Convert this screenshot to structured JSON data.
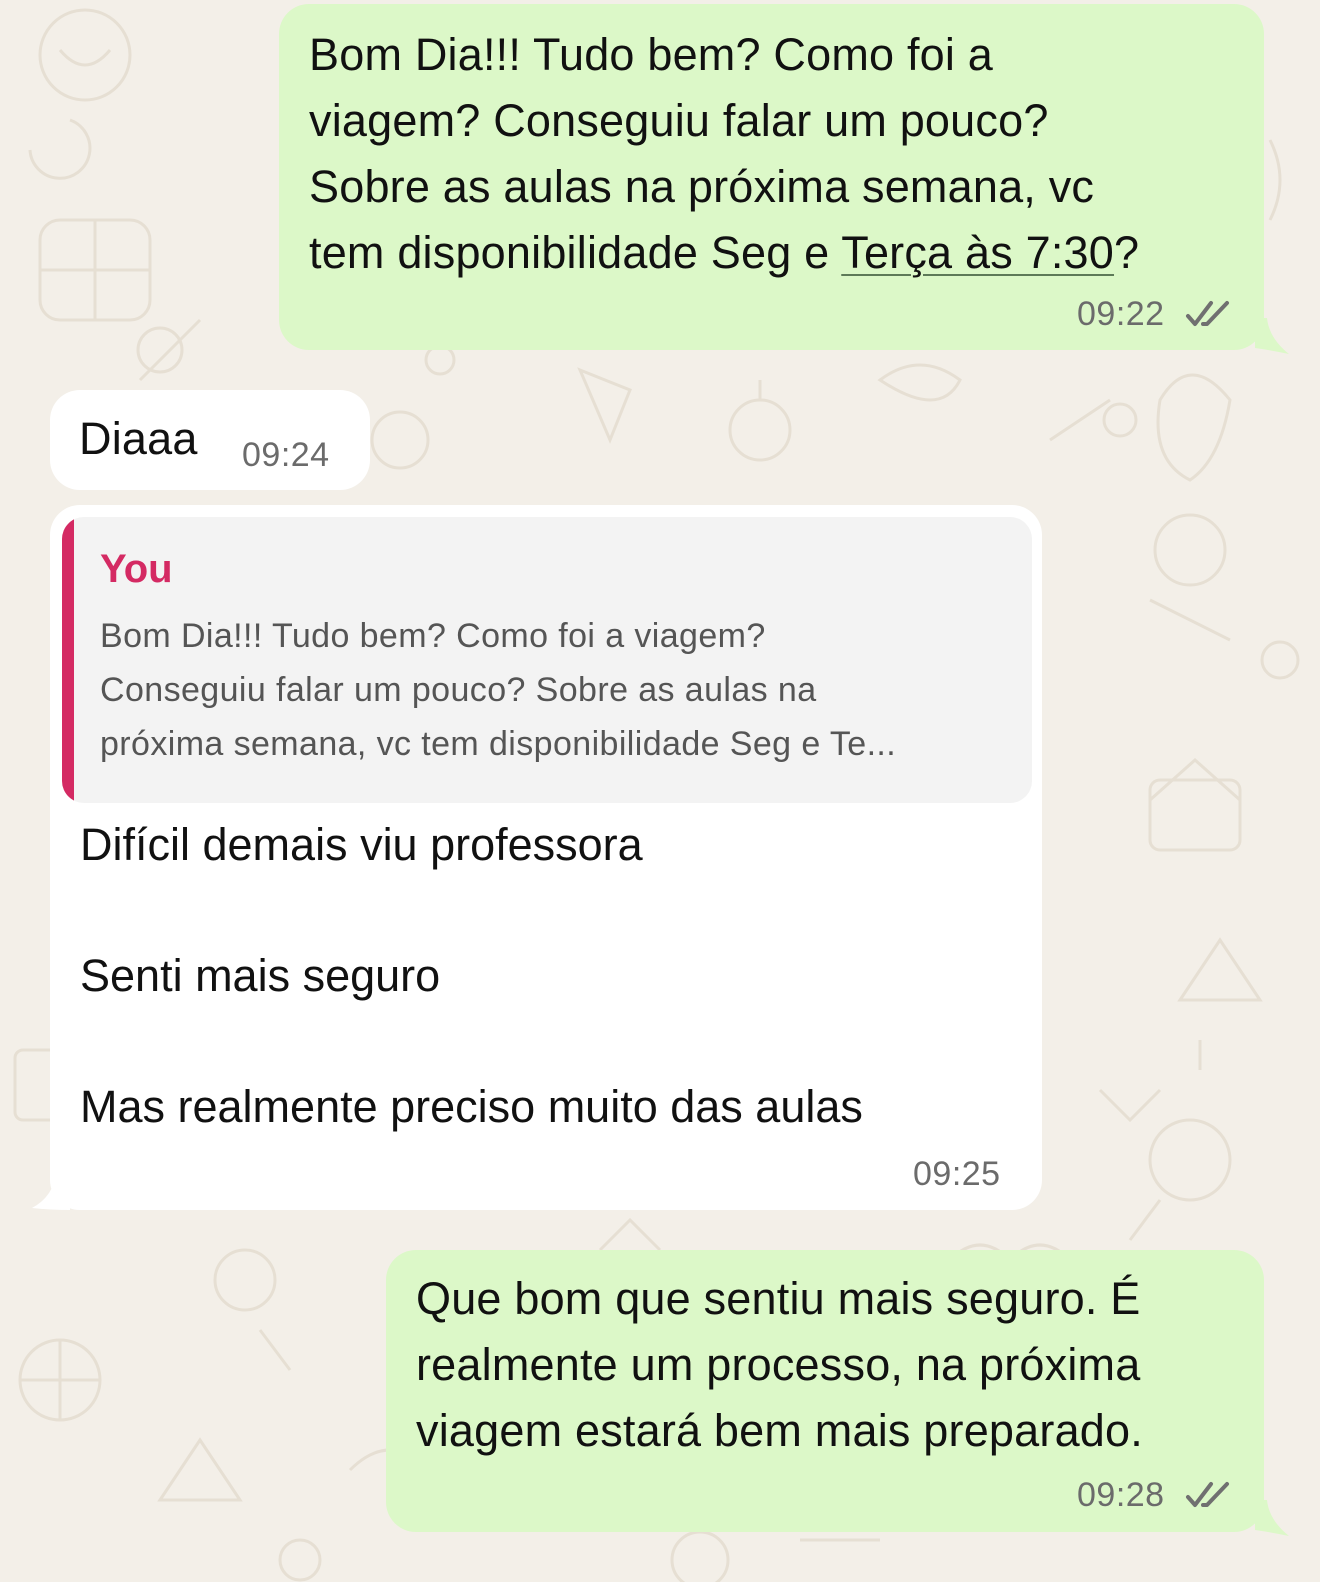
{
  "messages": [
    {
      "direction": "outgoing",
      "lines": [
        "Bom Dia!!! Tudo bem? Como foi a",
        "viagem? Conseguiu falar um pouco?",
        "Sobre as aulas na próxima semana, vc"
      ],
      "last_line_prefix": "tem disponibilidade Seg e ",
      "last_line_link": "Terça às 7:30",
      "last_line_suffix": "?",
      "time": "09:22",
      "status": "read"
    },
    {
      "direction": "incoming",
      "text": "Diaaa",
      "time": "09:24"
    },
    {
      "direction": "incoming",
      "quote": {
        "author": "You",
        "lines": [
          "Bom Dia!!! Tudo bem? Como foi a viagem?",
          "Conseguiu falar um pouco? Sobre as aulas na",
          "próxima semana, vc tem disponibilidade Seg e Te..."
        ]
      },
      "paragraphs": [
        "Difícil demais viu professora",
        "Senti mais seguro",
        "Mas realmente preciso muito das aulas"
      ],
      "time": "09:25"
    },
    {
      "direction": "outgoing",
      "lines": [
        "Que bom que sentiu mais seguro. É",
        "realmente um processo, na próxima",
        "viagem estará bem mais preparado."
      ],
      "time": "09:28",
      "status": "read"
    }
  ],
  "colors": {
    "outgoing_bubble": "#dcf8c8",
    "incoming_bubble": "#ffffff",
    "quote_accent": "#d42a63",
    "wallpaper": "#f3efe8"
  },
  "icons": [
    "double-check-icon"
  ]
}
